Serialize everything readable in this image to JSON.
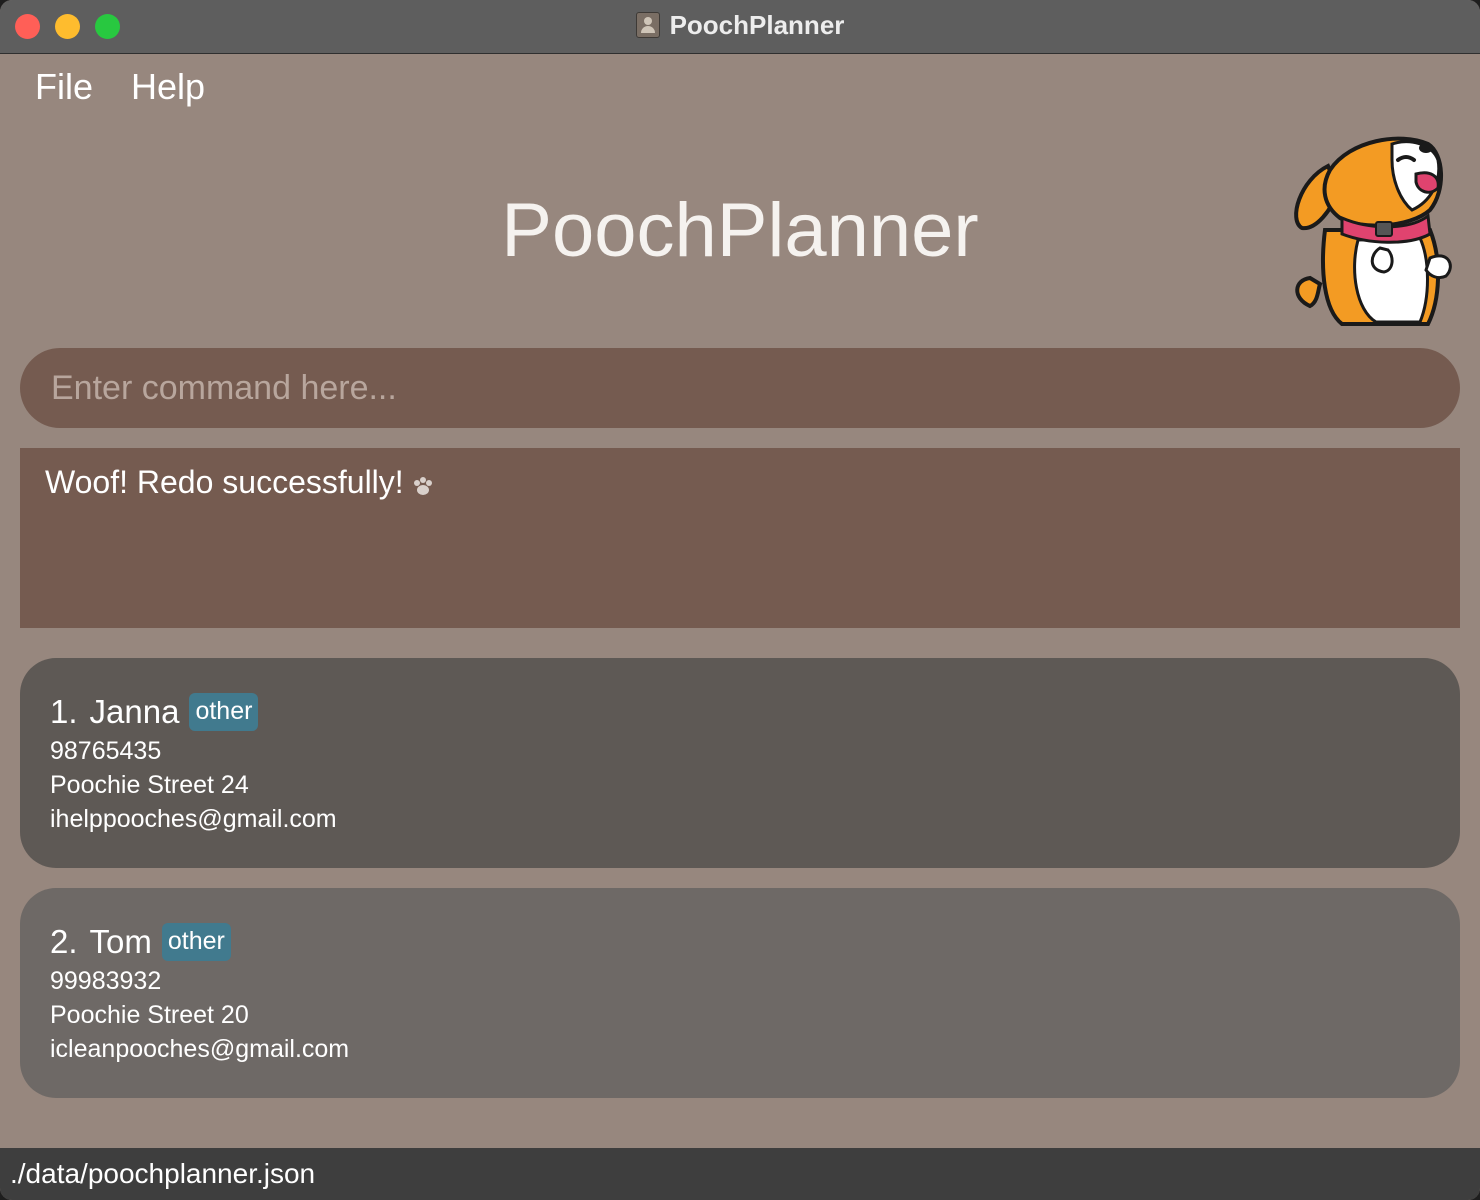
{
  "window": {
    "title": "PoochPlanner"
  },
  "menu": {
    "items": [
      {
        "label": "File"
      },
      {
        "label": "Help"
      }
    ]
  },
  "header": {
    "title": "PoochPlanner"
  },
  "command": {
    "value": "",
    "placeholder": "Enter command here..."
  },
  "result": {
    "message": "Woof! Redo successfully!"
  },
  "persons": [
    {
      "index": "1.",
      "name": "Janna",
      "tag": "other",
      "phone": "98765435",
      "address": "Poochie Street 24",
      "email": "ihelppooches@gmail.com"
    },
    {
      "index": "2.",
      "name": "Tom",
      "tag": "other",
      "phone": "99983932",
      "address": "Poochie Street 20",
      "email": "icleanpooches@gmail.com"
    }
  ],
  "status": {
    "file_path": "./data/poochplanner.json"
  },
  "colors": {
    "background": "#97877e",
    "command_box": "#755b50",
    "card_1": "#5e5955",
    "card_2": "#6e6966",
    "tag": "#417a8e",
    "status_bar": "#3e3e3e"
  }
}
